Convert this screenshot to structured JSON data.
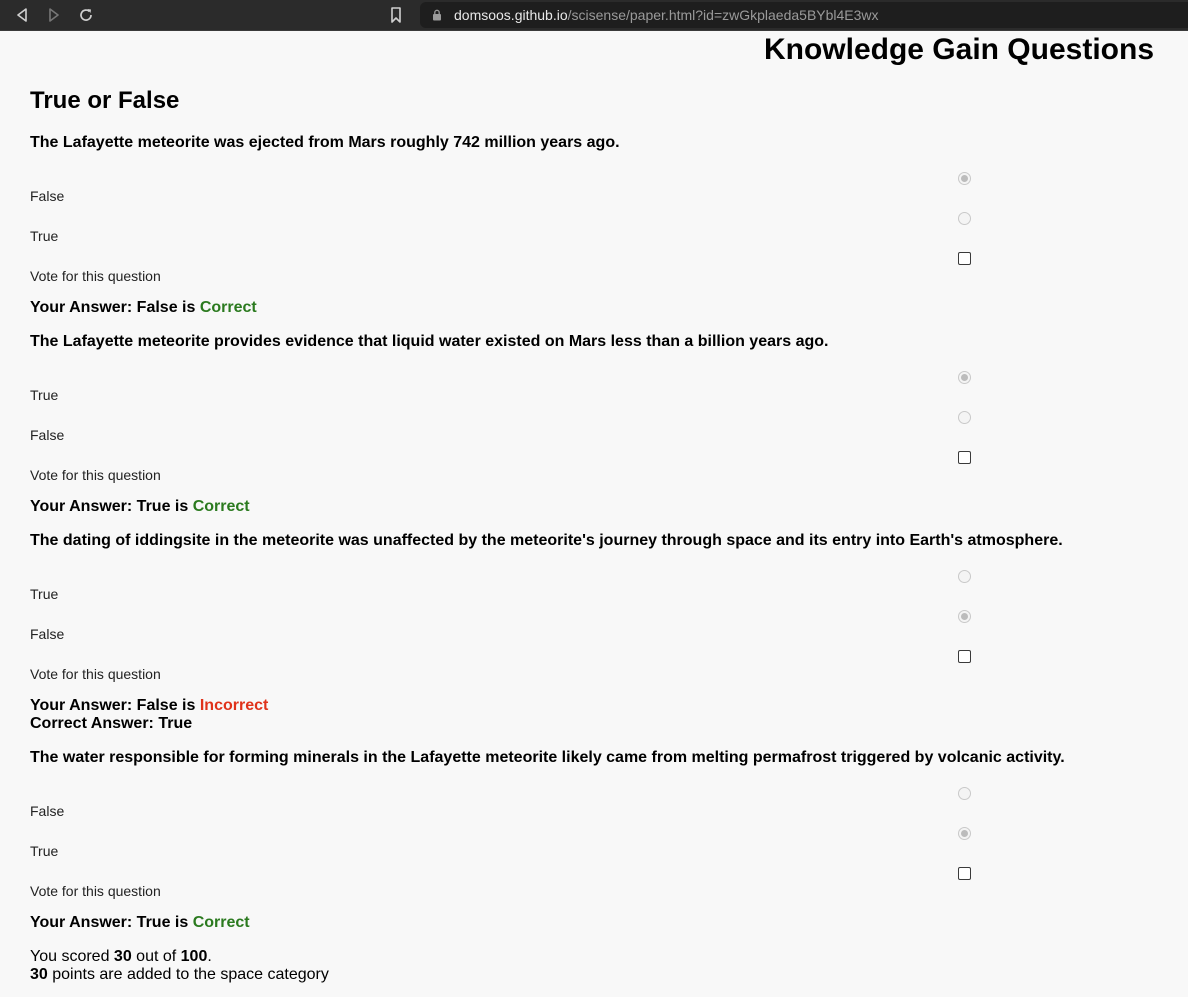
{
  "browser": {
    "url_host": "domsoos.github.io",
    "url_path": "/scisense/paper.html?id=zwGkplaeda5BYbl4E3wx"
  },
  "page": {
    "heading": "Knowledge Gain Questions",
    "section_title": "True or False"
  },
  "questions": [
    {
      "text": "The Lafayette meteorite was ejected from Mars roughly 742 million years ago.",
      "options": [
        "False",
        "True"
      ],
      "selected_index": 0,
      "vote_label": "Vote for this question",
      "answer_prefix": "Your Answer: False is",
      "result": "Correct"
    },
    {
      "text": "The Lafayette meteorite provides evidence that liquid water existed on Mars less than a billion years ago.",
      "options": [
        "True",
        "False"
      ],
      "selected_index": 0,
      "vote_label": "Vote for this question",
      "answer_prefix": "Your Answer: True is",
      "result": "Correct"
    },
    {
      "text": "The dating of iddingsite in the meteorite was unaffected by the meteorite's journey through space and its entry into Earth's atmosphere.",
      "options": [
        "True",
        "False"
      ],
      "selected_index": 1,
      "vote_label": "Vote for this question",
      "answer_prefix": "Your Answer: False is",
      "result": "Incorrect",
      "correct_answer": "Correct Answer: True"
    },
    {
      "text": "The water responsible for forming minerals in the Lafayette meteorite likely came from melting permafrost triggered by volcanic activity.",
      "options": [
        "False",
        "True"
      ],
      "selected_index": 1,
      "vote_label": "Vote for this question",
      "answer_prefix": "Your Answer: True is",
      "result": "Correct"
    }
  ],
  "score": {
    "line1_prefix": "You scored",
    "score": "30",
    "line1_mid": "out of",
    "total": "100",
    "line1_suffix": ".",
    "points": "30",
    "line2_suffix": "points are added to the space category"
  }
}
